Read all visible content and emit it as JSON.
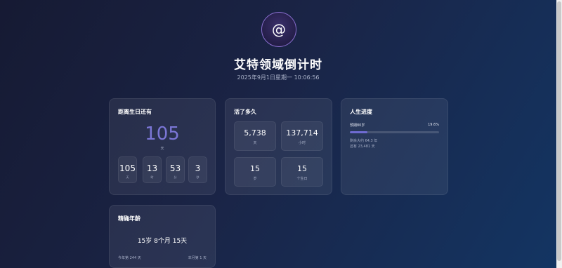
{
  "header": {
    "avatar_symbol": "@",
    "title": "艾特领域倒计时",
    "datetime": "2025年9月1日星期一 10:06:56"
  },
  "birthday": {
    "title": "距离生日还有",
    "big_value": "105",
    "big_unit": "天",
    "units": [
      {
        "value": "105",
        "label": "天"
      },
      {
        "value": "13",
        "label": "时"
      },
      {
        "value": "53",
        "label": "分"
      },
      {
        "value": "3",
        "label": "秒"
      }
    ]
  },
  "lived": {
    "title": "活了多久",
    "stats": [
      {
        "value": "5,738",
        "label": "天"
      },
      {
        "value": "137,714",
        "label": "小时"
      },
      {
        "value": "15",
        "label": "岁"
      },
      {
        "value": "15",
        "label": "个生日"
      }
    ]
  },
  "progress": {
    "title": "人生进度",
    "label": "预期80岁",
    "percent_text": "19.6%",
    "percent_value": 19.6,
    "remaining_years": "剩余大约 64.3 年",
    "remaining_days": "还有 23,481 天",
    "bar_color": "#6f6bd2"
  },
  "exact_age": {
    "title": "精确年龄",
    "value": "15岁 8个月 15天",
    "year_day": "今年第 244 天",
    "month_day": "本月第 1 天"
  }
}
